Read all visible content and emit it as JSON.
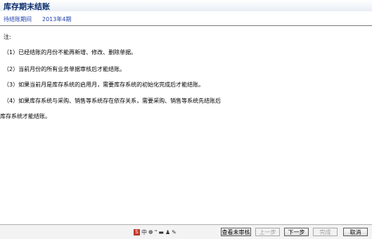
{
  "title": "库存期末结账",
  "period": {
    "label": "待结账期间",
    "value": "2013年4期"
  },
  "notes": [
    "注:",
    "（1）已经结账的月份不能再新增、修改、删除单据。",
    "（2）当前月份的所有业务单据审核后才能结账。",
    "（3）如果当前月是库存系统的启用月，需要库存系统的初始化完成后才能结账。",
    "（4）如果库存系统与采购、销售等系统存在依存关系，需要采购、销售等系统先结账后",
    "库存系统才能结账。"
  ],
  "ime": {
    "mode": "中",
    "glyphs": [
      "❁",
      "\"",
      "▬",
      "♟",
      "✎"
    ]
  },
  "buttons": {
    "view_unaudited": "查看未审核",
    "previous": "上一步",
    "next": "下一步",
    "finish": "完成",
    "cancel": "取消"
  }
}
